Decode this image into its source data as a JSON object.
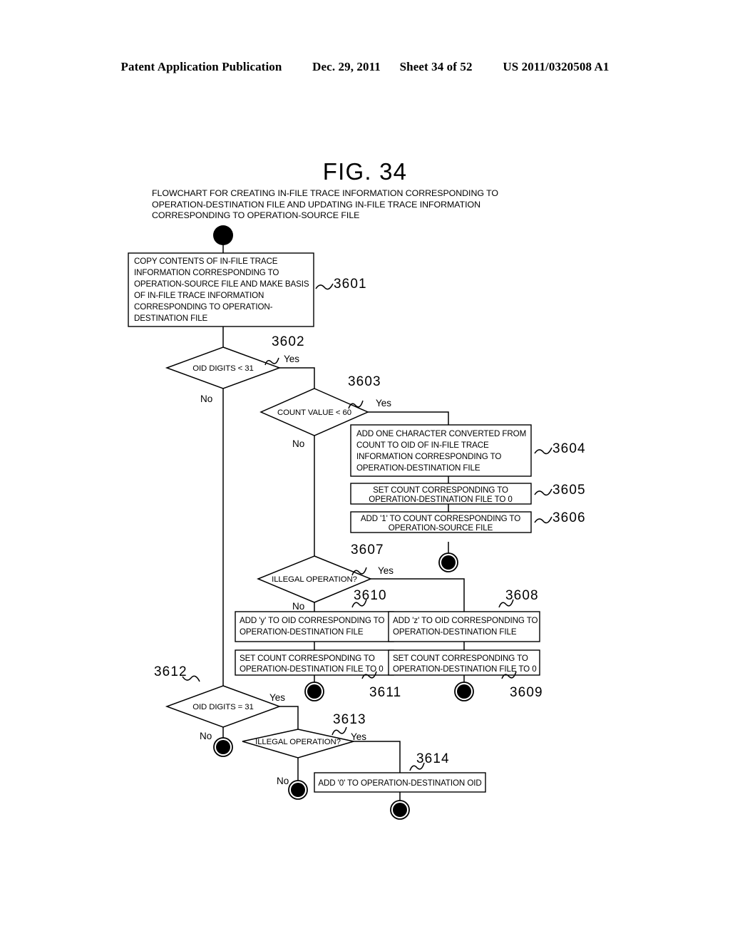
{
  "header": {
    "publication": "Patent Application Publication",
    "date": "Dec. 29, 2011",
    "sheet": "Sheet 34 of 52",
    "docnum": "US 2011/0320508 A1"
  },
  "figure": {
    "title": "FIG. 34",
    "subtitle_lines": [
      "FLOWCHART FOR CREATING IN-FILE TRACE INFORMATION CORRESPONDING TO",
      "OPERATION-DESTINATION FILE AND UPDATING IN-FILE TRACE INFORMATION",
      "CORRESPONDING TO OPERATION-SOURCE FILE"
    ]
  },
  "chart_data": {
    "type": "diagram",
    "diagram_kind": "flowchart",
    "title": "FIG. 34",
    "nodes": [
      {
        "id": "start",
        "kind": "terminator-start",
        "label": ""
      },
      {
        "id": "3601",
        "kind": "process",
        "ref": "3601",
        "lines": [
          "COPY CONTENTS OF IN-FILE TRACE",
          "INFORMATION CORRESPONDING TO",
          "OPERATION-SOURCE FILE AND MAKE BASIS",
          "OF IN-FILE TRACE INFORMATION",
          "CORRESPONDING TO OPERATION-",
          "DESTINATION FILE"
        ]
      },
      {
        "id": "3602",
        "kind": "decision",
        "ref": "3602",
        "lines": [
          "OID DIGITS < 31"
        ],
        "branches": {
          "yes": "Yes",
          "no": "No"
        }
      },
      {
        "id": "3603",
        "kind": "decision",
        "ref": "3603",
        "lines": [
          "COUNT VALUE < 60"
        ],
        "branches": {
          "yes": "Yes",
          "no": "No"
        }
      },
      {
        "id": "3604",
        "kind": "process",
        "ref": "3604",
        "lines": [
          "ADD ONE CHARACTER CONVERTED FROM",
          "COUNT TO OID OF IN-FILE TRACE",
          "INFORMATION CORRESPONDING TO",
          "OPERATION-DESTINATION FILE"
        ]
      },
      {
        "id": "3605",
        "kind": "process",
        "ref": "3605",
        "lines": [
          "SET COUNT CORRESPONDING TO",
          "OPERATION-DESTINATION FILE TO 0"
        ]
      },
      {
        "id": "3606",
        "kind": "process",
        "ref": "3606",
        "lines": [
          "ADD '1' TO COUNT CORRESPONDING TO",
          "OPERATION-SOURCE FILE"
        ]
      },
      {
        "id": "3607",
        "kind": "decision",
        "ref": "3607",
        "lines": [
          "ILLEGAL OPERATION?"
        ],
        "branches": {
          "yes": "Yes",
          "no": "No"
        }
      },
      {
        "id": "3608",
        "kind": "process",
        "ref": "3608",
        "lines": [
          "ADD 'z' TO OID CORRESPONDING TO",
          "OPERATION-DESTINATION FILE"
        ]
      },
      {
        "id": "3609",
        "kind": "process",
        "ref": "3609",
        "lines": [
          "SET COUNT CORRESPONDING TO",
          "OPERATION-DESTINATION FILE TO 0"
        ]
      },
      {
        "id": "3610",
        "kind": "process",
        "ref": "3610",
        "lines": [
          "ADD 'y' TO OID CORRESPONDING TO",
          "OPERATION-DESTINATION FILE"
        ]
      },
      {
        "id": "3611",
        "kind": "process",
        "ref": "3611",
        "lines": [
          "SET COUNT CORRESPONDING TO",
          "OPERATION-DESTINATION FILE TO 0"
        ]
      },
      {
        "id": "3612",
        "kind": "decision",
        "ref": "3612",
        "lines": [
          "OID DIGITS = 31"
        ],
        "branches": {
          "yes": "Yes",
          "no": "No"
        }
      },
      {
        "id": "3613",
        "kind": "decision",
        "ref": "3613",
        "lines": [
          "ILLEGAL OPERATION?"
        ],
        "branches": {
          "yes": "Yes",
          "no": "No"
        }
      },
      {
        "id": "3614",
        "kind": "process",
        "ref": "3614",
        "lines": [
          "ADD '0' TO OPERATION-DESTINATION OID"
        ]
      },
      {
        "id": "end-a",
        "kind": "terminator-end",
        "label": ""
      },
      {
        "id": "end-b",
        "kind": "terminator-end",
        "label": ""
      },
      {
        "id": "end-c",
        "kind": "terminator-end",
        "label": ""
      },
      {
        "id": "end-d",
        "kind": "terminator-end",
        "label": ""
      },
      {
        "id": "end-e",
        "kind": "terminator-end",
        "label": ""
      },
      {
        "id": "end-f",
        "kind": "terminator-end",
        "label": ""
      }
    ],
    "edges": [
      {
        "from": "start",
        "to": "3601",
        "label": ""
      },
      {
        "from": "3601",
        "to": "3602",
        "label": ""
      },
      {
        "from": "3602",
        "to": "3603",
        "label": "Yes"
      },
      {
        "from": "3602",
        "to": "3612",
        "label": "No"
      },
      {
        "from": "3603",
        "to": "3604",
        "label": "Yes"
      },
      {
        "from": "3603",
        "to": "3607",
        "label": "No"
      },
      {
        "from": "3604",
        "to": "3605",
        "label": ""
      },
      {
        "from": "3605",
        "to": "3606",
        "label": ""
      },
      {
        "from": "3606",
        "to": "end-a",
        "label": ""
      },
      {
        "from": "3607",
        "to": "3608",
        "label": "Yes"
      },
      {
        "from": "3607",
        "to": "3610",
        "label": "No"
      },
      {
        "from": "3608",
        "to": "3609",
        "label": ""
      },
      {
        "from": "3609",
        "to": "end-b",
        "label": ""
      },
      {
        "from": "3610",
        "to": "3611",
        "label": ""
      },
      {
        "from": "3611",
        "to": "end-c",
        "label": ""
      },
      {
        "from": "3612",
        "to": "3613",
        "label": "Yes"
      },
      {
        "from": "3612",
        "to": "end-d",
        "label": "No"
      },
      {
        "from": "3613",
        "to": "3614",
        "label": "Yes"
      },
      {
        "from": "3613",
        "to": "end-e",
        "label": "No"
      },
      {
        "from": "3614",
        "to": "end-f",
        "label": ""
      }
    ]
  },
  "labels": {
    "yes": "Yes",
    "no": "No",
    "ref_3601": "3601",
    "ref_3602": "3602",
    "ref_3603": "3603",
    "ref_3604": "3604",
    "ref_3605": "3605",
    "ref_3606": "3606",
    "ref_3607": "3607",
    "ref_3608": "3608",
    "ref_3609": "3609",
    "ref_3610": "3610",
    "ref_3611": "3611",
    "ref_3612": "3612",
    "ref_3613": "3613",
    "ref_3614": "3614"
  },
  "box_text": {
    "b3601": [
      "COPY CONTENTS OF IN-FILE TRACE",
      "INFORMATION CORRESPONDING TO",
      "OPERATION-SOURCE FILE AND MAKE BASIS",
      "OF IN-FILE TRACE INFORMATION",
      "CORRESPONDING TO OPERATION-",
      "DESTINATION FILE"
    ],
    "b3604": [
      "ADD ONE CHARACTER CONVERTED FROM",
      "COUNT TO OID OF IN-FILE TRACE",
      "INFORMATION CORRESPONDING TO",
      "OPERATION-DESTINATION FILE"
    ],
    "b3605": [
      "SET COUNT CORRESPONDING TO",
      "OPERATION-DESTINATION FILE TO 0"
    ],
    "b3606": [
      "ADD '1' TO COUNT CORRESPONDING TO",
      "OPERATION-SOURCE FILE"
    ],
    "b3608": [
      "ADD 'z' TO OID CORRESPONDING TO",
      "OPERATION-DESTINATION FILE"
    ],
    "b3609": [
      "SET COUNT CORRESPONDING TO",
      "OPERATION-DESTINATION FILE TO 0"
    ],
    "b3610": [
      "ADD 'y' TO OID CORRESPONDING TO",
      "OPERATION-DESTINATION FILE"
    ],
    "b3611": [
      "SET COUNT CORRESPONDING TO",
      "OPERATION-DESTINATION FILE TO 0"
    ],
    "b3614": [
      "ADD '0' TO OPERATION-DESTINATION OID"
    ],
    "d3602": "OID DIGITS < 31",
    "d3603": "COUNT VALUE < 60",
    "d3607": "ILLEGAL OPERATION?",
    "d3612": "OID DIGITS = 31",
    "d3613": "ILLEGAL OPERATION?"
  },
  "colors": {
    "ink": "#000000",
    "paper": "#ffffff"
  }
}
